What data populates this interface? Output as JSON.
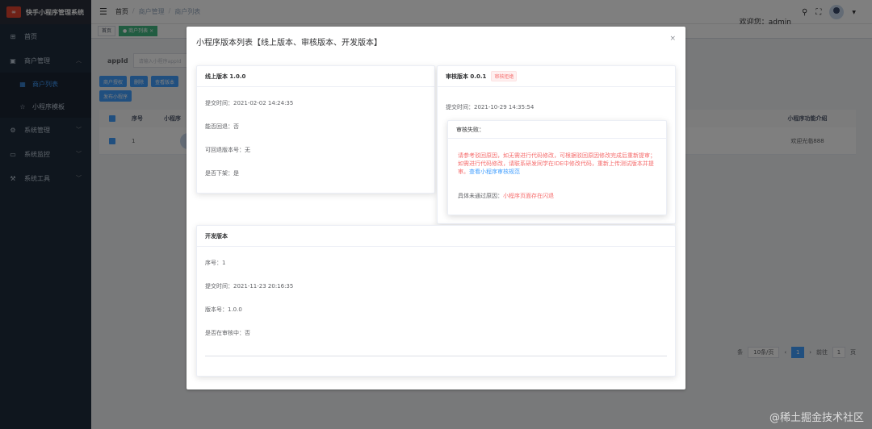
{
  "app": {
    "title": "快手小程序管理系统",
    "logo_icon": "logo-icon"
  },
  "sidebar": {
    "items": [
      {
        "label": "首页",
        "icon": "dashboard-icon",
        "glyph": "⊞"
      },
      {
        "label": "商户管理",
        "icon": "store-icon",
        "glyph": "▣",
        "expanded": true
      },
      {
        "label": "商户列表",
        "icon": "grid-icon",
        "glyph": "▦",
        "sub": true,
        "active": true
      },
      {
        "label": "小程序模板",
        "icon": "star-icon",
        "glyph": "☆",
        "sub": true
      },
      {
        "label": "系统管理",
        "icon": "gear-icon",
        "glyph": "⚙"
      },
      {
        "label": "系统监控",
        "icon": "monitor-icon",
        "glyph": "▭"
      },
      {
        "label": "系统工具",
        "icon": "tool-icon",
        "glyph": "⚒"
      }
    ]
  },
  "header": {
    "breadcrumb": [
      "首页",
      "商户管理",
      "商户列表"
    ],
    "welcome": "欢迎您：admin"
  },
  "tags": [
    {
      "label": "首页",
      "active": false
    },
    {
      "label": "● 商户列表 ×",
      "active": true
    }
  ],
  "page": {
    "search_label": "appId",
    "search_placeholder": "请输入小程序appId",
    "buttons": [
      "商户授权",
      "删除",
      "查看版本",
      "发布小程序"
    ],
    "table": {
      "headers": [
        "序号",
        "小程序",
        "小程序功能介绍"
      ],
      "rows": [
        {
          "index": "1",
          "intro": "欢迎光临888"
        }
      ]
    },
    "pagination": {
      "suffix": "条",
      "page_size": "10条/页",
      "current": "1",
      "goto_label": "前往",
      "goto_value": "1",
      "page_unit": "页"
    }
  },
  "dialog": {
    "title": "小程序版本列表【线上版本、审核版本、开发版本】",
    "close": "×",
    "online": {
      "header": "线上版本 1.0.0",
      "submit_time": "提交时间：2021-02-02 14:24:35",
      "can_rollback": "能否回退：否",
      "rollback_version": "可回退版本号：无",
      "removed": "是否下架：是"
    },
    "audit": {
      "header": "审核版本 0.0.1",
      "status_badge": "审核拒绝",
      "submit_time": "提交时间：2021-10-29 14:35:54",
      "fail_title": "审核失败：",
      "fail_message": "请参考驳回原因，如无需进行代码修改，可根据驳回原因修改完成后重新提审；如需进行代码修改，请联系研发同学在IDE中修改代码，重新上传测试版本并提审。",
      "fail_link": "查看小程序审核规范",
      "reason_label": "具体未通过原因：",
      "reason_value": "小程序页面存在闪退"
    },
    "dev": {
      "header": "开发版本",
      "seq": "序号：1",
      "submit_time": "提交时间：2021-11-23 20:16:35",
      "version": "版本号：1.0.0",
      "in_audit": "是否在审核中：否"
    }
  },
  "watermark": "@稀土掘金技术社区",
  "colors": {
    "primary": "#409eff",
    "danger": "#f56c6c",
    "sidebar": "#1f2d3d",
    "tag_active": "#42b983"
  }
}
